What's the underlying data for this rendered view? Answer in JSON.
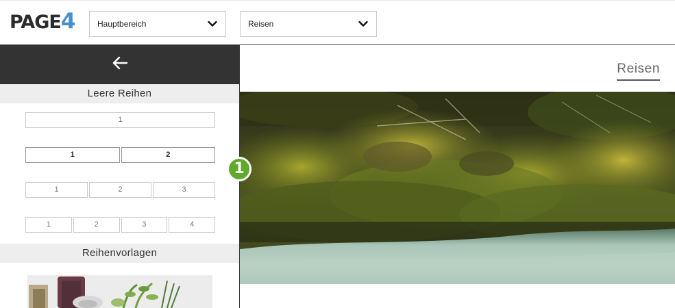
{
  "app": {
    "logo_text": "PAGE",
    "logo_digit": "4"
  },
  "toolbar": {
    "area_select": {
      "value": "Hauptbereich"
    },
    "page_select": {
      "value": "Reisen"
    }
  },
  "panel": {
    "empty_rows_title": "Leere Reihen",
    "rows": [
      [
        "1"
      ],
      [
        "1",
        "2"
      ],
      [
        "1",
        "2",
        "3"
      ],
      [
        "1",
        "2",
        "3",
        "4"
      ]
    ],
    "templates_title": "Reihenvorlagen"
  },
  "badge": {
    "number": "1",
    "color": "#5faa2a"
  },
  "main": {
    "page_link": "Reisen"
  },
  "colors": {
    "panel_header": "#333333",
    "section_bg": "#eeeeee",
    "logo_accent": "#4a90c8"
  }
}
